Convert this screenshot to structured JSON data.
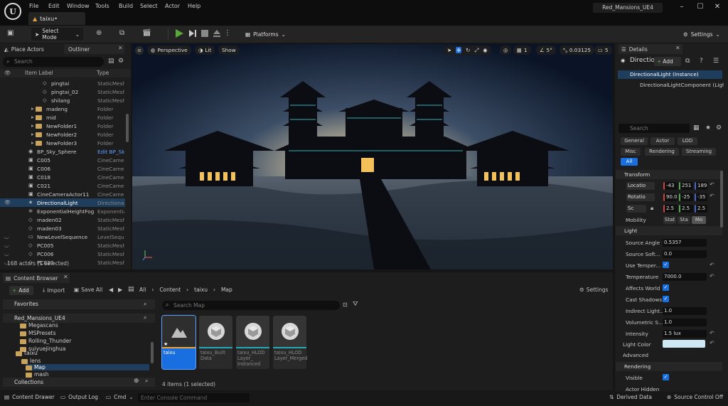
{
  "title_bar": {
    "menus": [
      "File",
      "Edit",
      "Window",
      "Tools",
      "Build",
      "Select",
      "Actor",
      "Help"
    ],
    "doc_tab": "taixu•",
    "project": "Red_Mansions_UE4"
  },
  "toolbar": {
    "select_mode": "Select Mode",
    "platforms": "Platforms",
    "settings": "Settings"
  },
  "outliner": {
    "tab_place": "Place Actors",
    "tab_outliner": "Outliner",
    "search_placeholder": "Search",
    "col_label": "Item Label",
    "col_type": "Type",
    "rows": [
      {
        "name": "pingtai",
        "type": "StaticMesh"
      },
      {
        "name": "pingtai_02",
        "type": "StaticMesh"
      },
      {
        "name": "shilang",
        "type": "StaticMesh"
      },
      {
        "name": "madeng",
        "type": "Folder"
      },
      {
        "name": "mid",
        "type": "Folder"
      },
      {
        "name": "NewFolder1",
        "type": "Folder"
      },
      {
        "name": "NewFolder2",
        "type": "Folder"
      },
      {
        "name": "NewFolder3",
        "type": "Folder"
      },
      {
        "name": "BP_Sky_Sphere",
        "type": "Edit BP_Sky"
      },
      {
        "name": "C005",
        "type": "CineCamera"
      },
      {
        "name": "C006",
        "type": "CineCamera"
      },
      {
        "name": "C018",
        "type": "CineCamera"
      },
      {
        "name": "C021",
        "type": "CineCamera"
      },
      {
        "name": "CineCameraActor11",
        "type": "CineCamera"
      },
      {
        "name": "DirectionalLight",
        "type": "Directional"
      },
      {
        "name": "ExponentialHeightFog",
        "type": "Exponential"
      },
      {
        "name": "maden02",
        "type": "StaticMesh"
      },
      {
        "name": "maden03",
        "type": "StaticMesh"
      },
      {
        "name": "NewLevelSequence",
        "type": "LevelSequ"
      },
      {
        "name": "PC005",
        "type": "StaticMesh"
      },
      {
        "name": "PC006",
        "type": "StaticMesh"
      },
      {
        "name": "PC020",
        "type": "StaticMesh"
      }
    ],
    "count": "168 actors (1 selected)"
  },
  "viewport": {
    "perspective": "Perspective",
    "lit": "Lit",
    "show": "Show",
    "grid_value": "1",
    "angle_value": "5°",
    "scale_value": "0.03125",
    "camera_speed": "5"
  },
  "details": {
    "tab": "Details",
    "actor_name": "Directio",
    "add": "Add",
    "instance": "DirectionalLight (Instance)",
    "component": "DirectionalLightComponent (LightC",
    "search_placeholder": "Search",
    "filters": [
      "General",
      "Actor",
      "LOD",
      "Misc",
      "Rendering",
      "Streaming",
      "All"
    ],
    "sections": {
      "transform": "Transform",
      "light": "Light",
      "rendering": "Rendering",
      "advanced": "Advanced"
    },
    "location_label": "Locatio",
    "location": [
      "-43",
      "251",
      "189"
    ],
    "rotation_label": "Rotatio",
    "rotation": [
      "90.0",
      "-25",
      "-35"
    ],
    "scale_label": "Sc",
    "scale": [
      "2.5",
      "2.5",
      "2.5"
    ],
    "mobility_label": "Mobility",
    "mobility": [
      "Stat",
      "Sta",
      "Mo"
    ],
    "props": [
      {
        "label": "Source Angle",
        "value": "0.5357"
      },
      {
        "label": "Source Soft...",
        "value": "0.0"
      },
      {
        "label": "Use Temper...",
        "value": ""
      },
      {
        "label": "Temperature",
        "value": "7000.0"
      },
      {
        "label": "Affects World",
        "value": ""
      },
      {
        "label": "Cast Shadows",
        "value": ""
      },
      {
        "label": "Indirect Light...",
        "value": "1.0"
      },
      {
        "label": "Volumetric S...",
        "value": "1.0"
      },
      {
        "label": "Intensity",
        "value": "1.5 lux"
      }
    ],
    "light_color": "Light Color",
    "light_color_hex": "#cde8f2",
    "visible": "Visible",
    "actor_hidden": "Actor Hidden"
  },
  "content_browser": {
    "tab": "Content Browser",
    "add": "Add",
    "import": "Import",
    "save_all": "Save All",
    "breadcrumb": [
      "All",
      "Content",
      "taixu",
      "Map"
    ],
    "settings": "Settings",
    "favorites": "Favorites",
    "project": "Red_Mansions_UE4",
    "tree": [
      "Megascans",
      "MSPresets",
      "Rolling_Thunder",
      "suiyuejinghua",
      "taixu",
      "lens",
      "Map",
      "mash"
    ],
    "collections": "Collections",
    "search_placeholder": "Search Map",
    "assets": [
      {
        "name": "taixu"
      },
      {
        "name": "taixu_Built Data"
      },
      {
        "name": "taixu_HLOD Layer_ Instanced"
      },
      {
        "name": "taixu_HLOD Layer_Merged"
      }
    ],
    "count": "4 items (1 selected)"
  },
  "status": {
    "content_drawer": "Content Drawer",
    "output_log": "Output Log",
    "cmd": "Cmd",
    "console_placeholder": "Enter Console Command",
    "derived_data": "Derived Data",
    "source_control": "Source Control Off"
  },
  "colors": {
    "accent": "#1a6fe0",
    "selection": "#1f3e5e",
    "play": "#5aa83a"
  }
}
